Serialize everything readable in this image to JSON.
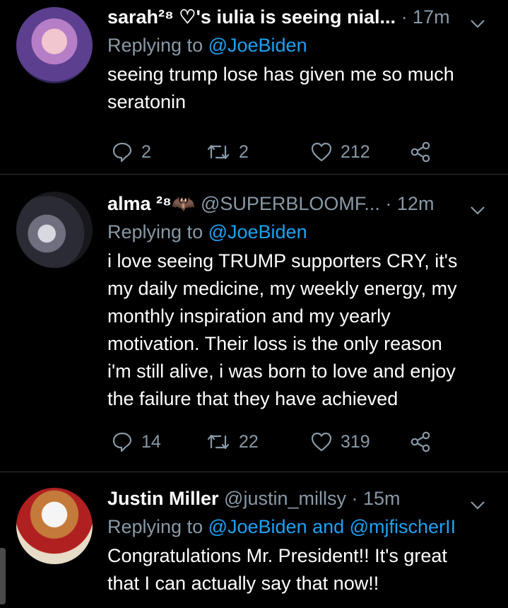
{
  "colors": {
    "background": "#000000",
    "text": "#ffffff",
    "muted": "#8899a6",
    "link": "#1da1f2",
    "divider": "#2f3336"
  },
  "tweets": [
    {
      "name": "sarah²⁸ ♡'s iulia is seeing nial...",
      "handle": "",
      "time": "· 17m",
      "replying_prefix": "Replying to ",
      "mentions": "@JoeBiden",
      "lines": [
        "seeing trump lose has given me so much",
        "seratonin"
      ],
      "replies": "2",
      "retweets": "2",
      "likes": "212"
    },
    {
      "name": "alma ²⁸🦇",
      "handle": "@SUPERBLOOMF...",
      "time": "· 12m",
      "replying_prefix": "Replying to ",
      "mentions": "@JoeBiden",
      "lines": [
        "i love seeing TRUMP supporters CRY, it's",
        "my daily medicine, my weekly energy, my",
        "monthly inspiration and my yearly",
        "motivation. Their loss is the only reason",
        "i'm still alive, i was born to love and enjoy",
        "the failure that they have achieved"
      ],
      "replies": "14",
      "retweets": "22",
      "likes": "319"
    },
    {
      "name": "Justin Miller",
      "handle": "@justin_millsy",
      "time": "· 15m",
      "replying_prefix": "Replying to ",
      "mentions": "@JoeBiden and @mjfischerII",
      "lines": [
        "Congratulations Mr. President!! It's great",
        "that I can actually say that now!!"
      ]
    }
  ]
}
